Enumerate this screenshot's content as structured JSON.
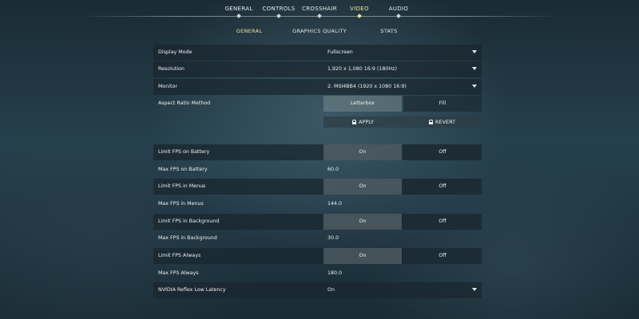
{
  "nav": {
    "tabs": [
      {
        "label": "GENERAL"
      },
      {
        "label": "CONTROLS"
      },
      {
        "label": "CROSSHAIR"
      },
      {
        "label": "VIDEO"
      },
      {
        "label": "AUDIO"
      }
    ],
    "active": "VIDEO"
  },
  "subnav": {
    "tabs": [
      {
        "label": "GENERAL"
      },
      {
        "label": "GRAPHICS QUALITY"
      },
      {
        "label": "STATS"
      }
    ],
    "active": "GENERAL"
  },
  "settings": {
    "display_mode": {
      "label": "Display Mode",
      "value": "Fullscreen"
    },
    "resolution": {
      "label": "Resolution",
      "value": "1,920 x 1,080 16:9 (180Hz)"
    },
    "monitor": {
      "label": "Monitor",
      "value": "2. MSI4BB4 (1920 x 1080 16:9)"
    },
    "aspect_ratio": {
      "label": "Aspect Ratio Method",
      "option_a": "Letterbox",
      "option_b": "Fill",
      "selected": "Letterbox"
    },
    "apply_label": "APPLY",
    "revert_label": "REVERT",
    "limit_fps_battery": {
      "label": "Limit FPS on Battery",
      "on": "On",
      "off": "Off",
      "selected": "On"
    },
    "max_fps_battery": {
      "label": "Max FPS on Battery",
      "value": "60.0"
    },
    "limit_fps_menus": {
      "label": "Limit FPS in Menus",
      "on": "On",
      "off": "Off",
      "selected": "On"
    },
    "max_fps_menus": {
      "label": "Max FPS in Menus",
      "value": "144.0"
    },
    "limit_fps_background": {
      "label": "Limit FPS in Background",
      "on": "On",
      "off": "Off",
      "selected": "On"
    },
    "max_fps_background": {
      "label": "Max FPS in Background",
      "value": "30.0"
    },
    "limit_fps_always": {
      "label": "Limit FPS Always",
      "on": "On",
      "off": "Off",
      "selected": "On"
    },
    "max_fps_always": {
      "label": "Max FPS Always",
      "value": "180.0"
    },
    "nvidia_reflex": {
      "label": "NVIDIA Reflex Low Latency",
      "value": "On"
    }
  },
  "colors": {
    "accent": "#ece59a",
    "text": "#eef1f1"
  }
}
